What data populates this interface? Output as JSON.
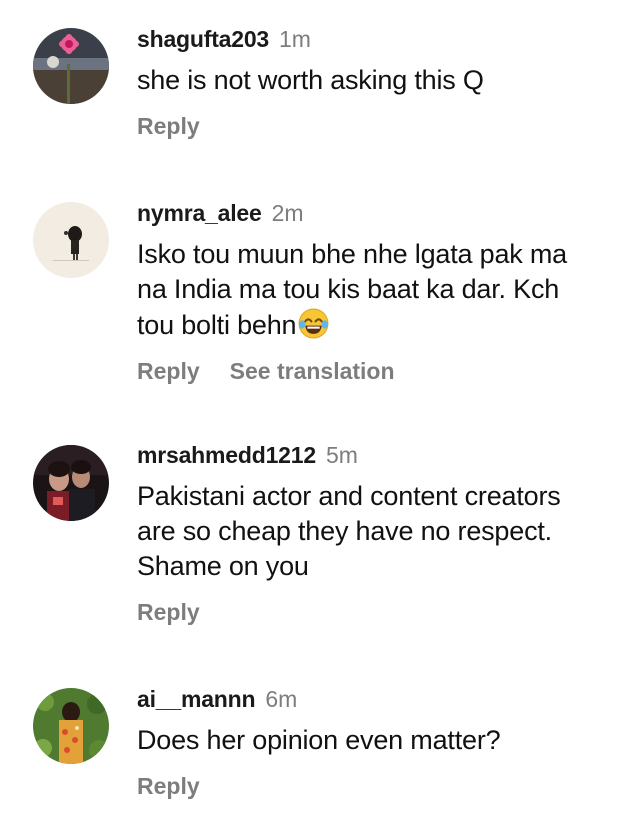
{
  "comments": [
    {
      "username": "shagufta203",
      "time": "1m",
      "text": "she is not worth asking this Q",
      "actions": [
        "Reply"
      ]
    },
    {
      "username": "nymra_alee",
      "time": "2m",
      "text_lines": [
        "Isko tou muun bhe nhe lgata pak ma",
        "na India ma tou kis baat ka dar. Kch",
        "tou bolti behn"
      ],
      "emoji": "face-with-tears-of-joy-icon",
      "actions": [
        "Reply",
        "See translation"
      ]
    },
    {
      "username": "mrsahmedd1212",
      "time": "5m",
      "text_lines": [
        "Pakistani actor and content creators",
        "are so cheap they have no respect.",
        "Shame on you"
      ],
      "actions": [
        "Reply"
      ]
    },
    {
      "username": "ai__mannn",
      "time": "6m",
      "text": "Does her opinion even matter?",
      "actions": [
        "Reply"
      ]
    }
  ],
  "colors": {
    "username": "#1a1a1a",
    "secondary": "#7d7d7d",
    "text": "#111111",
    "background": "#ffffff"
  }
}
